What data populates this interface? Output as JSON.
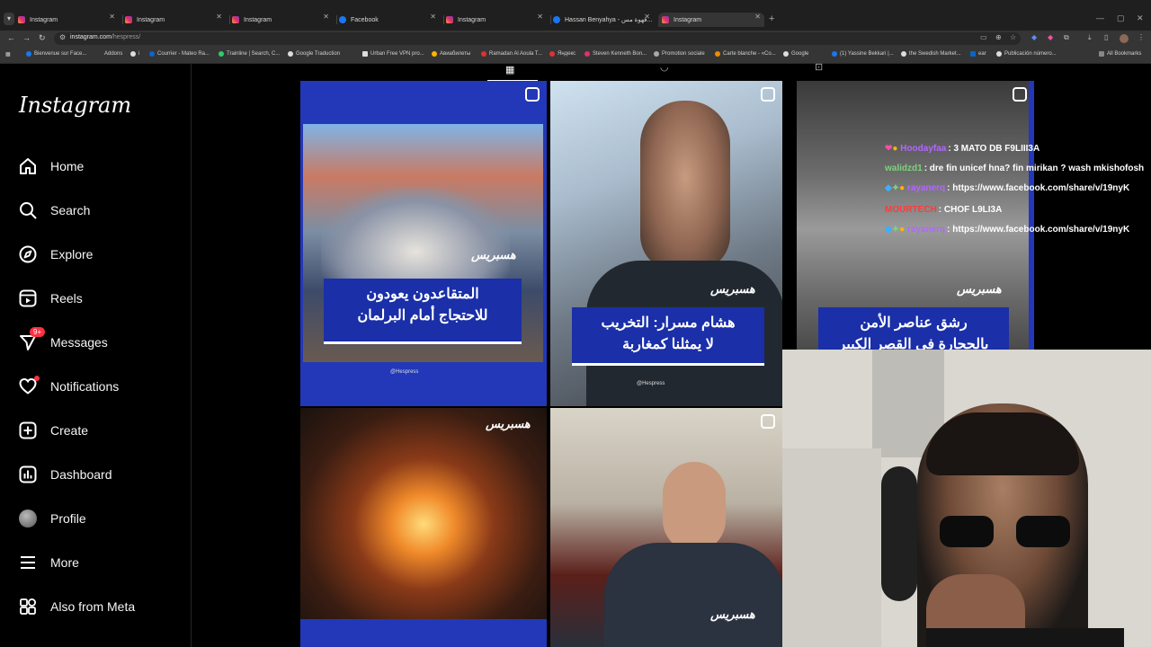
{
  "browser": {
    "tabs": [
      {
        "title": "Instagram",
        "icon": "instagram"
      },
      {
        "title": "Instagram",
        "icon": "instagram"
      },
      {
        "title": "Instagram",
        "icon": "instagram"
      },
      {
        "title": "Facebook",
        "icon": "facebook"
      },
      {
        "title": "Instagram",
        "icon": "instagram"
      },
      {
        "title": "Hassan Benyahya - قهوة مس...",
        "icon": "facebook"
      },
      {
        "title": "Instagram",
        "icon": "instagram"
      }
    ],
    "url_host": "instagram.com",
    "url_path": "/hespress/",
    "bookmarks": [
      "Bienvenue sur Face...",
      "Addons",
      "i",
      "Courrier - Mateo Ra...",
      "Trainline | Search, C...",
      "Google Traduction",
      "Urban Free VPN pro...",
      "Авиабилеты",
      "Ramadan Al Aoula T...",
      "Яндекс",
      "Steven Kenneth Bon...",
      "Promotion sociale",
      "Carte blanche - «Co...",
      "Google",
      "(1) Yassine Bekkari |...",
      "the Swedish Market...",
      "ear",
      "Publicación número...",
      "All Bookmarks"
    ]
  },
  "instagram": {
    "logo": "Instagram",
    "nav": [
      {
        "label": "Home",
        "icon": "home-icon"
      },
      {
        "label": "Search",
        "icon": "search-icon"
      },
      {
        "label": "Explore",
        "icon": "compass-icon"
      },
      {
        "label": "Reels",
        "icon": "reels-icon"
      },
      {
        "label": "Messages",
        "icon": "messages-icon",
        "badge": "9+"
      },
      {
        "label": "Notifications",
        "icon": "heart-icon"
      },
      {
        "label": "Create",
        "icon": "plus-icon"
      },
      {
        "label": "Dashboard",
        "icon": "dashboard-icon"
      },
      {
        "label": "Profile",
        "icon": "avatar"
      },
      {
        "label": "More",
        "icon": "menu-icon"
      },
      {
        "label": "Also from Meta",
        "icon": "meta-apps-icon"
      }
    ],
    "posts": [
      {
        "caption_line1": "المتقاعدون يعودون",
        "caption_line2": "للاحتجاج أمام البرلمان",
        "watermark": "هسبريس",
        "handle": "@Hespress"
      },
      {
        "caption_line1": "هشام مسرار: التخريب",
        "caption_line2": "لا يمثلنا كمغاربة",
        "watermark": "هسبريس",
        "handle": "@Hespress"
      },
      {
        "caption_line1": "رشق عناصر الأمن",
        "caption_line2": "بالحجارة في القصر الكبير",
        "watermark": "هسبريس"
      },
      {
        "watermark": "هسبريس"
      },
      {
        "watermark": "هسبريس"
      }
    ]
  },
  "chat": [
    {
      "user": "Hoodayfaa",
      "message": ": 3 MATO DB F9LIII3A",
      "color": "#b266ff"
    },
    {
      "user": "walidzd1",
      "message": ": dre fin unicef hna? fin mirikan ? wash mkishofosh",
      "color": "#7fd17f"
    },
    {
      "user": "rayanerq",
      "message": ": https://www.facebook.com/share/v/19nyK",
      "color": "#b266ff"
    },
    {
      "user": "MOURTECH",
      "message": ": CHOF L9LI3A",
      "color": "#ff3b3b"
    },
    {
      "user": "rayanerq",
      "message": ": https://www.facebook.com/share/v/19nyK",
      "color": "#b266ff"
    }
  ]
}
